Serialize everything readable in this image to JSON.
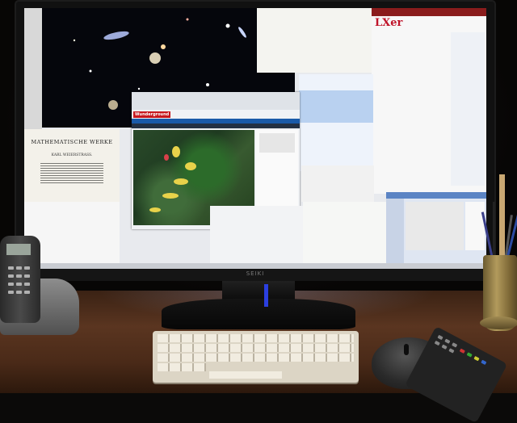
{
  "monitor": {
    "brand": "SEIKI"
  },
  "document": {
    "title": "MATHEMATISCHE WERKE",
    "author": "KARL WEIERSTRASS."
  },
  "lxer": {
    "logo": "LXer"
  },
  "weather": {
    "logo": "Wunderground"
  },
  "colors": {
    "lxer_red": "#c0142a",
    "wu_red": "#c7181e",
    "wu_blue": "#1a5aa8",
    "monitor_led": "#2b3fe0",
    "keyboard": "#dcd5c5"
  }
}
